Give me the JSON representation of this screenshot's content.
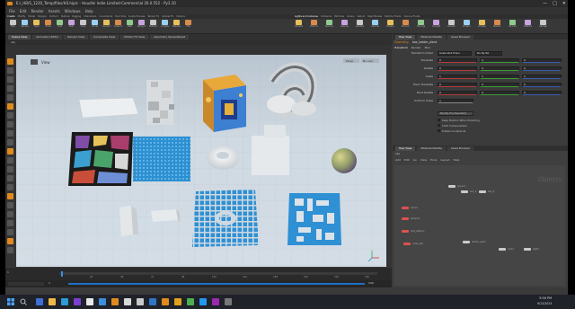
{
  "window": {
    "title": "E:/_HB/S_1220_Temp/files/H3.hip/c - Houdini Indie Limited-Commercial 20.0.552 - Py3.10",
    "controls": [
      "—",
      "□",
      "✕"
    ]
  },
  "menu": [
    "File",
    "Edit",
    "Render",
    "Assets",
    "Windows",
    "Help"
  ],
  "shelf_tabs": [
    "Create",
    "Modify",
    "Model",
    "Polygon",
    "Deform",
    "Texture",
    "Rigging",
    "Characters",
    "Constraints",
    "Hair Utils",
    "Guide Process",
    "Terrain FX",
    "Simple FX",
    "Volume"
  ],
  "shelf_tools": [
    "Box",
    "Sphere",
    "Tube",
    "Torus",
    "Grid",
    "Null",
    "Line",
    "Circle",
    "Curve Bezier",
    "Draw Curve",
    "Path",
    "Spray Paint",
    "Platonic Solids",
    "L-System",
    "Metaball",
    "File"
  ],
  "right_shelf_tabs": [
    "Lights and Cameras",
    "Collisions",
    "Particles",
    "Grains",
    "Vellum",
    "Rigid Bodies",
    "Particle Fluids",
    "Viscous Fluids"
  ],
  "right_shelf_tools": [
    "Camera",
    "Point Light",
    "Spot Light",
    "Area Light",
    "Geometry Light",
    "Volume Light",
    "Distant Light",
    "Environment Light",
    "Sky Light",
    "GI Light",
    "Caustic Light",
    "Portal Light",
    "Ambient Light",
    "Stereo Camera",
    "VR Camera",
    "Switcher",
    "Gamepad Camera"
  ],
  "left_pane_tabs": [
    "Scene View",
    "Animation Editor",
    "Render View",
    "Composite View",
    "Motion FX View",
    "Geometry Spreadsheet"
  ],
  "viewport": {
    "path": "obj",
    "view_label": "View",
    "persp_label": "Persp",
    "cam_label": "No cam"
  },
  "right_pane_tabs": [
    "Tree View",
    "Material Palette",
    "Asset Browser"
  ],
  "params": {
    "node_type": "Geometry",
    "node_name": "box_ladder_plant",
    "subtabs": [
      "Transform",
      "Render",
      "Misc"
    ],
    "transform_order_label": "Transform Order",
    "transform_order_value": "Scale Rot Trans",
    "rotate_order_value": "Rx Ry Rz",
    "rows": [
      {
        "label": "Translate",
        "values": [
          "0",
          "0",
          "0"
        ]
      },
      {
        "label": "Rotate",
        "values": [
          "0",
          "0",
          "0"
        ]
      },
      {
        "label": "Scale",
        "values": [
          "1",
          "1",
          "1"
        ]
      },
      {
        "label": "Pivot Translate",
        "values": [
          "0",
          "0",
          "0"
        ]
      },
      {
        "label": "Pivot Rotate",
        "values": [
          "0",
          "0",
          "0"
        ]
      },
      {
        "label": "Uniform Scale",
        "values": [
          "1"
        ]
      }
    ],
    "modify_button": "Modify Pre-Transform",
    "checkboxes": [
      "Keep Position When Parenting",
      "Child Compensation",
      "Enable Constraints"
    ]
  },
  "network": {
    "tabs": [
      "Tree View",
      "Material Palette",
      "Asset Browser"
    ],
    "path": "obj",
    "menu": [
      "Add",
      "Edit",
      "Go",
      "View",
      "Tools",
      "Layout",
      "Help"
    ],
    "context_label": "Objects",
    "nodes": [
      {
        "label": "ground"
      },
      {
        "label": "box_a"
      },
      {
        "label": "box_b"
      },
      {
        "label": "torus1"
      },
      {
        "label": "sphere1"
      },
      {
        "label": "grid_pattern"
      },
      {
        "label": "ladder_plant"
      },
      {
        "label": "noise_tile"
      },
      {
        "label": "cam1"
      },
      {
        "label": "light1"
      }
    ]
  },
  "timeline": {
    "frame_start": "1",
    "frame_end": "240",
    "current_frame": "1",
    "tick_labels": [
      "24",
      "48",
      "72",
      "96",
      "120",
      "144",
      "168",
      "192",
      "216",
      "240"
    ],
    "range_end": "240",
    "keys_label": "0 keys, 0/0 channels",
    "key_all_label": "Key All Channels",
    "auto_update": "Auto Update"
  },
  "taskbar": {
    "time": "3:56 PM",
    "date": "9/12/2024"
  },
  "colors": {
    "accent": "#e08a1e",
    "node_red": "#d9534f",
    "viewport_bg": "#cdd7df"
  }
}
